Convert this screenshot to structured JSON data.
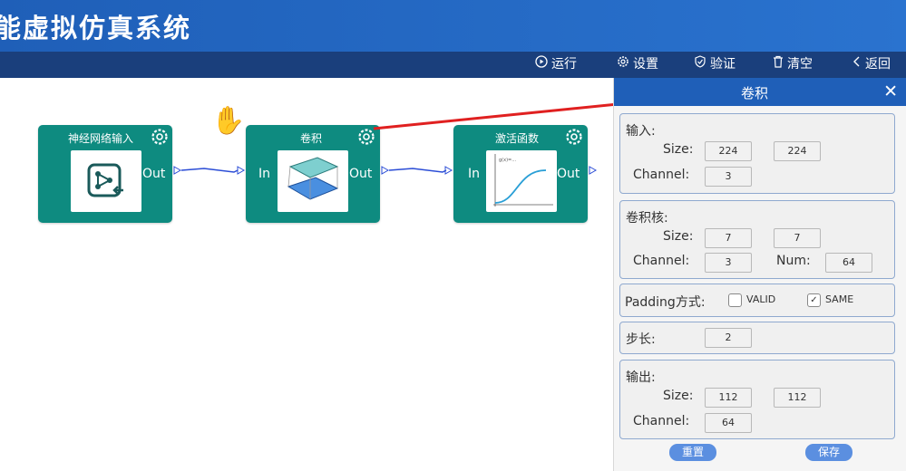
{
  "app": {
    "title": "能虚拟仿真系统"
  },
  "toolbar": {
    "run": "运行",
    "settings": "设置",
    "verify": "验证",
    "clear": "清空",
    "back": "返回"
  },
  "nodes": [
    {
      "title": "神经网络输入",
      "out": "Out"
    },
    {
      "title": "卷积",
      "in": "In",
      "out": "Out"
    },
    {
      "title": "激活函数",
      "in": "In",
      "out": "Out"
    }
  ],
  "panel": {
    "title": "卷积",
    "input": {
      "heading": "输入:",
      "size_label": "Size:",
      "size_w": "224",
      "size_h": "224",
      "channel_label": "Channel:",
      "channel": "3"
    },
    "kernel": {
      "heading": "卷积核:",
      "size_label": "Size:",
      "size_w": "7",
      "size_h": "7",
      "channel_label": "Channel:",
      "channel": "3",
      "num_label": "Num:",
      "num": "64"
    },
    "padding": {
      "label": "Padding方式:",
      "valid": "VALID",
      "same": "SAME",
      "selected": "SAME"
    },
    "stride": {
      "label": "步长:",
      "value": "2"
    },
    "output": {
      "heading": "输出:",
      "size_label": "Size:",
      "size_w": "112",
      "size_h": "112",
      "channel_label": "Channel:",
      "channel": "64"
    },
    "reset": "重置",
    "save": "保存"
  },
  "colors": {
    "title_bar": "#1f5fb8",
    "toolbar": "#1a3f7c",
    "node": "#0e8b80",
    "arrow": "#e02020",
    "link": "#2a4cd6"
  }
}
